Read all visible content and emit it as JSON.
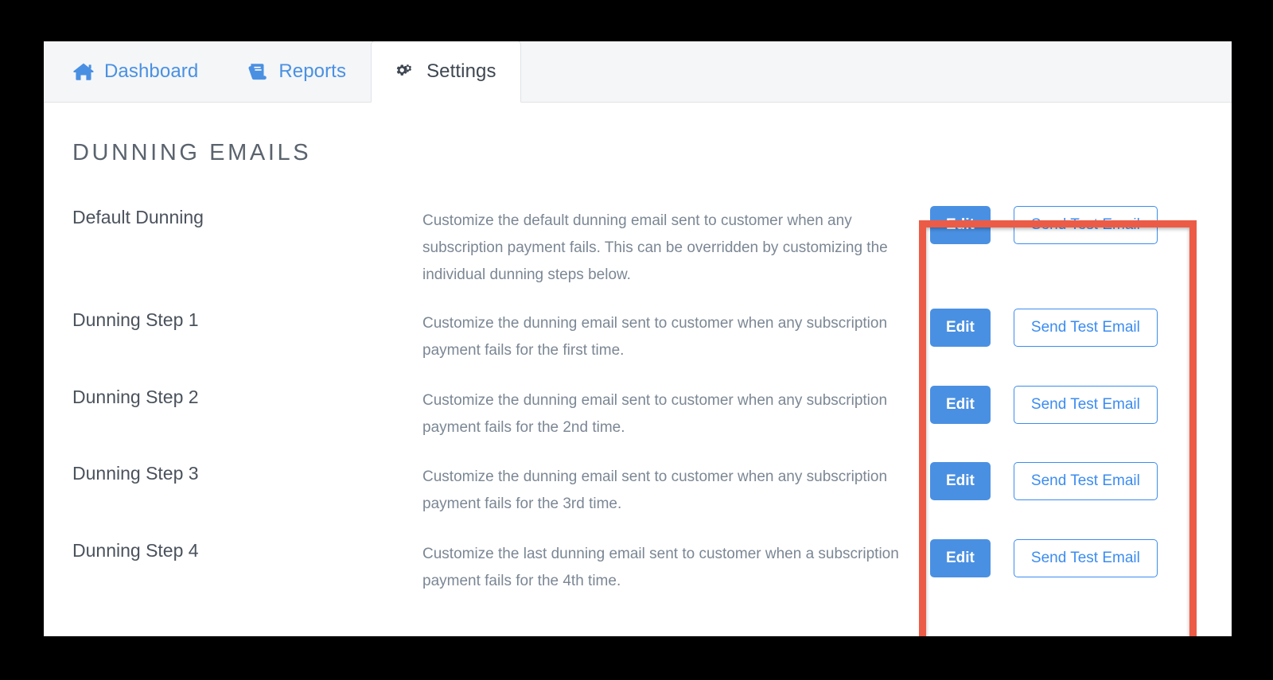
{
  "window": {
    "background_color": "#ffffff",
    "outer_background_color": "#000000"
  },
  "tabs": [
    {
      "id": "dashboard",
      "label": "Dashboard",
      "icon": "home-icon",
      "active": false
    },
    {
      "id": "reports",
      "label": "Reports",
      "icon": "book-icon",
      "active": false
    },
    {
      "id": "settings",
      "label": "Settings",
      "icon": "cogs-icon",
      "active": true
    }
  ],
  "page": {
    "title": "DUNNING EMAILS"
  },
  "rows": [
    {
      "name": "Default Dunning",
      "description": "Customize the default dunning email sent to customer when any subscription payment fails. This can be overridden by customizing the individual dunning steps below.",
      "edit_label": "Edit",
      "send_test_label": "Send Test Email"
    },
    {
      "name": "Dunning Step 1",
      "description": "Customize the dunning email sent to customer when any subscription payment fails for the first time.",
      "edit_label": "Edit",
      "send_test_label": "Send Test Email"
    },
    {
      "name": "Dunning Step 2",
      "description": "Customize the dunning email sent to customer when any subscription payment fails for the 2nd time.",
      "edit_label": "Edit",
      "send_test_label": "Send Test Email"
    },
    {
      "name": "Dunning Step 3",
      "description": "Customize the dunning email sent to customer when any subscription payment fails for the 3rd time.",
      "edit_label": "Edit",
      "send_test_label": "Send Test Email"
    },
    {
      "name": "Dunning Step 4",
      "description": "Customize the last dunning email sent to customer when a subscription payment fails for the 4th time.",
      "edit_label": "Edit",
      "send_test_label": "Send Test Email"
    }
  ],
  "annotation": {
    "type": "highlight-rectangle",
    "color": "#ec5b46"
  },
  "colors": {
    "primary_blue": "#4a90e2",
    "link_blue": "#3b8cf0",
    "outline_blue": "#3b8cf0",
    "title_gray": "#5a636d",
    "body_gray": "#7b8794",
    "tab_active_text": "#3e4751",
    "tabbar_background": "#f4f6f8",
    "highlight_red": "#ec5b46"
  }
}
